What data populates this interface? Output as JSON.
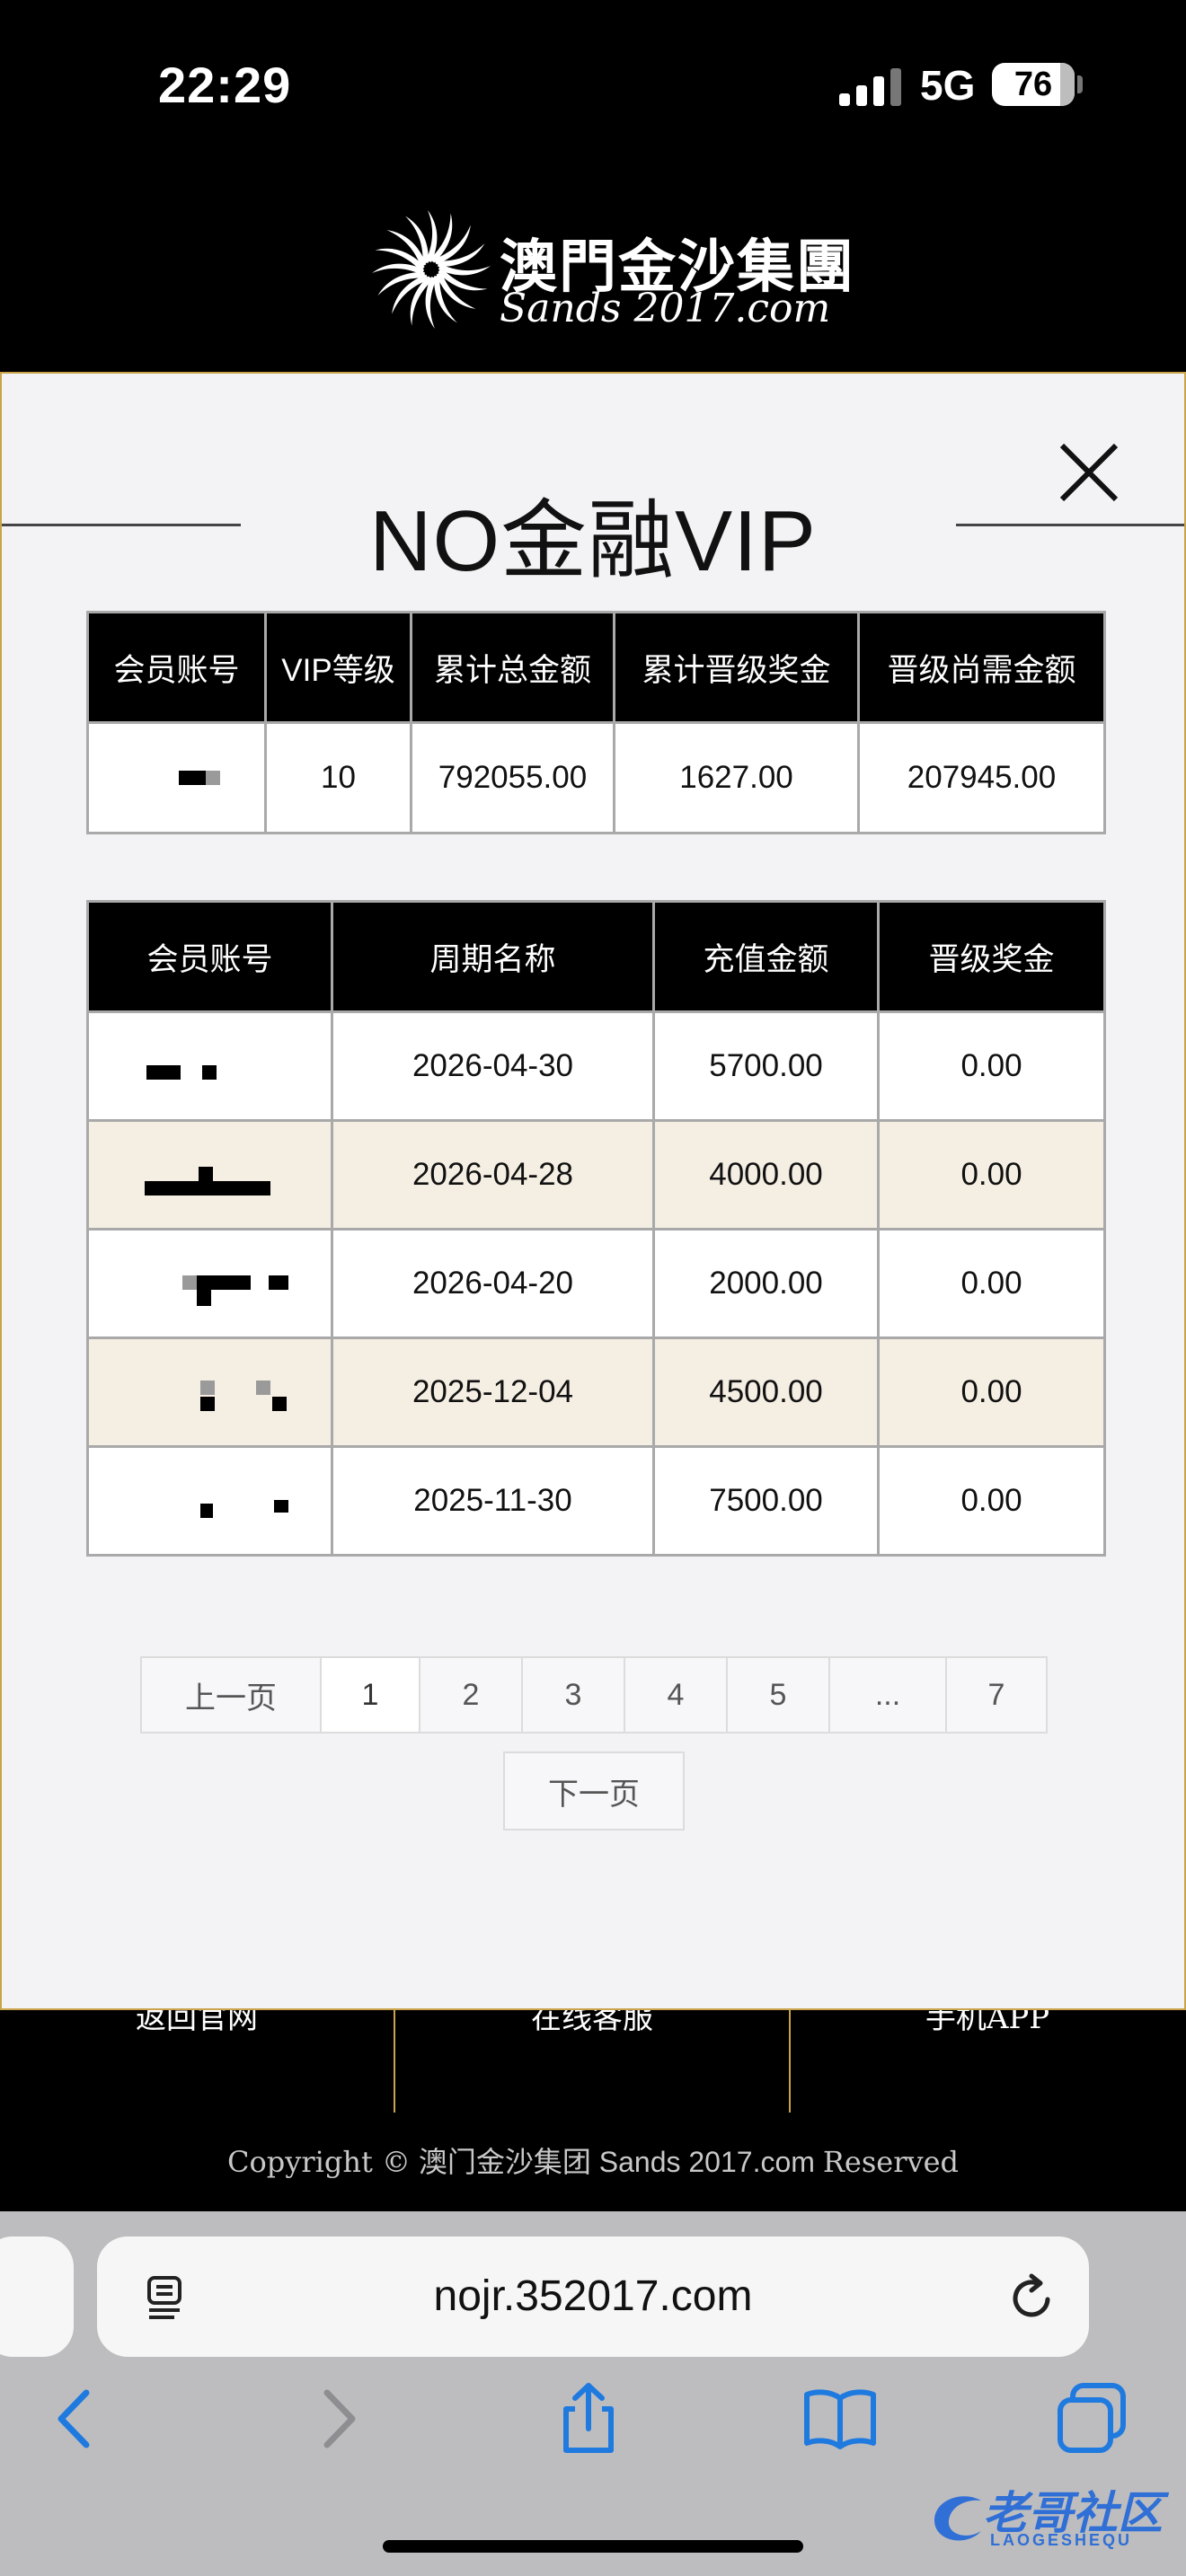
{
  "status_bar": {
    "time": "22:29",
    "network": "5G",
    "battery": "76"
  },
  "header": {
    "logo_cn": "澳門金沙集團",
    "logo_en": "Sands 2017.com"
  },
  "modal": {
    "title": "NO金融VIP",
    "summary_table": {
      "headers": [
        "会员账号",
        "VIP等级",
        "累计总金额",
        "累计晋级奖金",
        "晋级尚需金额"
      ],
      "row": {
        "account": "",
        "vip_level": "10",
        "total_amount": "792055.00",
        "total_bonus": "1627.00",
        "needed_amount": "207945.00"
      }
    },
    "records_table": {
      "headers": [
        "会员账号",
        "周期名称",
        "充值金额",
        "晋级奖金"
      ],
      "rows": [
        {
          "account": "",
          "period": "2026-04-30",
          "deposit": "5700.00",
          "bonus": "0.00"
        },
        {
          "account": "",
          "period": "2026-04-28",
          "deposit": "4000.00",
          "bonus": "0.00"
        },
        {
          "account": "",
          "period": "2026-04-20",
          "deposit": "2000.00",
          "bonus": "0.00"
        },
        {
          "account": "",
          "period": "2025-12-04",
          "deposit": "4500.00",
          "bonus": "0.00"
        },
        {
          "account": "",
          "period": "2025-11-30",
          "deposit": "7500.00",
          "bonus": "0.00"
        }
      ]
    },
    "pagination": {
      "prev": "上一页",
      "pages": [
        "1",
        "2",
        "3",
        "4",
        "5",
        "...",
        "7"
      ],
      "current": "1",
      "next": "下一页"
    }
  },
  "footer": {
    "nav": [
      "返回官网",
      "在线客服",
      "手机APP"
    ],
    "copyright_prefix": "Copyright ©",
    "copyright_brand": "澳门金沙集团 Sands 2017.com",
    "copyright_suffix": "Reserved"
  },
  "browser": {
    "url": "nojr.352017.com"
  },
  "watermark": {
    "text": "老哥社区",
    "sub": "LAOGESHEQU"
  },
  "colors": {
    "accent_gold": "#c9a44a",
    "row_alt": "#f5eee3",
    "header_black": "#000000"
  }
}
